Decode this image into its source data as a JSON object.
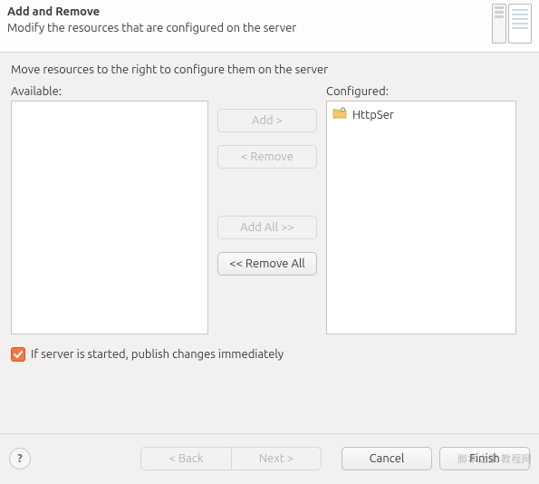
{
  "header": {
    "title": "Add and Remove",
    "subtitle": "Modify the resources that are configured on the server"
  },
  "body": {
    "instruction": "Move resources to the right to configure them on the server",
    "available_label": "Available:",
    "configured_label": "Configured:",
    "available_items": [],
    "configured_items": [
      {
        "icon": "project",
        "label": "HttpSer"
      }
    ],
    "buttons": {
      "add": "Add >",
      "remove": "< Remove",
      "add_all": "Add All >>",
      "remove_all": "<< Remove All"
    },
    "checkbox": {
      "checked": true,
      "label": "If server is started, publish changes immediately"
    }
  },
  "footer": {
    "help": "?",
    "back": "< Back",
    "next": "Next >",
    "cancel": "Cancel",
    "finish": "Finish"
  },
  "watermark": "脚本之家 教程网"
}
